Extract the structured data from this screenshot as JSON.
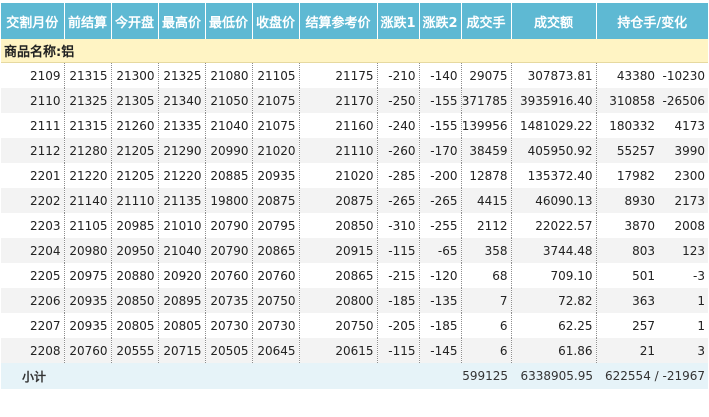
{
  "columns": [
    "交割月份",
    "前结算",
    "今开盘",
    "最高价",
    "最低价",
    "收盘价",
    "结算参考价",
    "涨跌1",
    "涨跌2",
    "成交手",
    "成交额",
    "持仓手/变化"
  ],
  "category_label": "商品名称:铝",
  "rows": [
    [
      "2109",
      "21315",
      "21300",
      "21325",
      "21080",
      "21105",
      "21175",
      "-210",
      "-140",
      "29075",
      "307873.81",
      "43380",
      "-10230"
    ],
    [
      "2110",
      "21325",
      "21305",
      "21340",
      "21050",
      "21075",
      "21170",
      "-250",
      "-155",
      "371785",
      "3935916.40",
      "310858",
      "-26506"
    ],
    [
      "2111",
      "21315",
      "21260",
      "21335",
      "21040",
      "21075",
      "21160",
      "-240",
      "-155",
      "139956",
      "1481029.22",
      "180332",
      "4173"
    ],
    [
      "2112",
      "21280",
      "21205",
      "21290",
      "20990",
      "21020",
      "21110",
      "-260",
      "-170",
      "38459",
      "405950.92",
      "55257",
      "3990"
    ],
    [
      "2201",
      "21220",
      "21205",
      "21220",
      "20885",
      "20935",
      "21020",
      "-285",
      "-200",
      "12878",
      "135372.40",
      "17982",
      "2300"
    ],
    [
      "2202",
      "21140",
      "21110",
      "21135",
      "19800",
      "20875",
      "20875",
      "-265",
      "-265",
      "4415",
      "46090.13",
      "8930",
      "2173"
    ],
    [
      "2203",
      "21105",
      "20985",
      "21010",
      "20790",
      "20795",
      "20850",
      "-310",
      "-255",
      "2112",
      "22022.57",
      "3870",
      "2008"
    ],
    [
      "2204",
      "20980",
      "20950",
      "21040",
      "20790",
      "20865",
      "20915",
      "-115",
      "-65",
      "358",
      "3744.48",
      "803",
      "123"
    ],
    [
      "2205",
      "20975",
      "20880",
      "20920",
      "20760",
      "20760",
      "20865",
      "-215",
      "-120",
      "68",
      "709.10",
      "501",
      "-3"
    ],
    [
      "2206",
      "20935",
      "20850",
      "20895",
      "20735",
      "20750",
      "20800",
      "-185",
      "-135",
      "7",
      "72.82",
      "363",
      "1"
    ],
    [
      "2207",
      "20935",
      "20805",
      "20805",
      "20730",
      "20730",
      "20750",
      "-205",
      "-185",
      "6",
      "62.25",
      "257",
      "1"
    ],
    [
      "2208",
      "20760",
      "20555",
      "20715",
      "20505",
      "20645",
      "20615",
      "-115",
      "-145",
      "6",
      "61.86",
      "21",
      "3"
    ]
  ],
  "summary": {
    "label": "小计",
    "volume": "599125",
    "turnover": "6338905.95",
    "open_interest": "622554 / -21967"
  }
}
